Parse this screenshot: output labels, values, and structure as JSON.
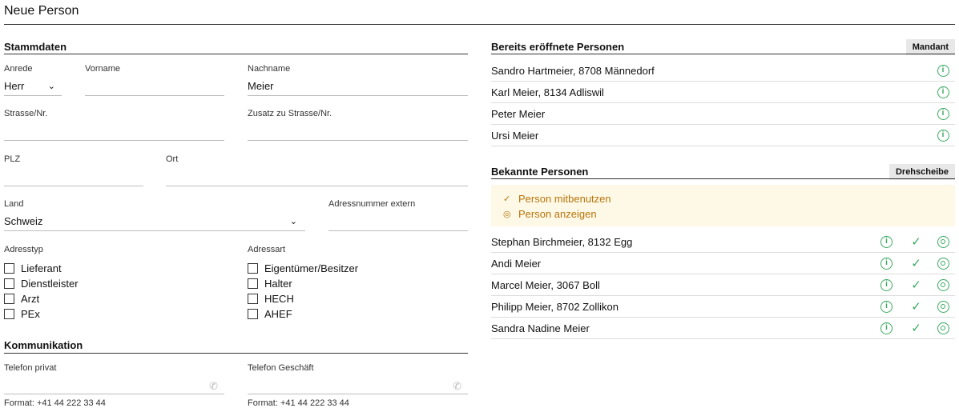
{
  "title": "Neue Person",
  "stammdaten": {
    "heading": "Stammdaten",
    "anrede": {
      "label": "Anrede",
      "value": "Herr"
    },
    "vorname": {
      "label": "Vorname",
      "value": ""
    },
    "nachname": {
      "label": "Nachname",
      "value": "Meier"
    },
    "strasse": {
      "label": "Strasse/Nr.",
      "value": ""
    },
    "zusatz": {
      "label": "Zusatz zu Strasse/Nr.",
      "value": ""
    },
    "plz": {
      "label": "PLZ",
      "value": ""
    },
    "ort": {
      "label": "Ort",
      "value": ""
    },
    "land": {
      "label": "Land",
      "value": "Schweiz"
    },
    "adressnummer": {
      "label": "Adressnummer extern",
      "value": ""
    },
    "adresstyp": {
      "label": "Adresstyp",
      "options": [
        "Lieferant",
        "Dienstleister",
        "Arzt",
        "PEx"
      ]
    },
    "adressart": {
      "label": "Adressart",
      "options": [
        "Eigentümer/Besitzer",
        "Halter",
        "HECH",
        "AHEF"
      ]
    }
  },
  "kommunikation": {
    "heading": "Kommunikation",
    "tel_privat": {
      "label": "Telefon privat",
      "hint": "Format: +41 44 222 33 44"
    },
    "tel_geschaeft": {
      "label": "Telefon Geschäft",
      "hint": "Format: +41 44 222 33 44"
    }
  },
  "bereits": {
    "heading": "Bereits eröffnete Personen",
    "tag": "Mandant",
    "rows": [
      "Sandro Hartmeier, 8708 Männedorf",
      "Karl Meier, 8134 Adliswil",
      "Peter Meier",
      "Ursi Meier"
    ]
  },
  "bekannte": {
    "heading": "Bekannte Personen",
    "tag": "Drehscheibe",
    "legend": {
      "use": "Person mitbenutzen",
      "show": "Person anzeigen"
    },
    "rows": [
      "Stephan Birchmeier, 8132 Egg",
      "Andi Meier",
      "Marcel Meier, 3067 Boll",
      "Philipp Meier, 8702 Zollikon",
      "Sandra Nadine Meier"
    ]
  },
  "colors": {
    "green": "#3aa860",
    "hint_bg": "#fdf9e6",
    "hint_text": "#b8740c"
  }
}
